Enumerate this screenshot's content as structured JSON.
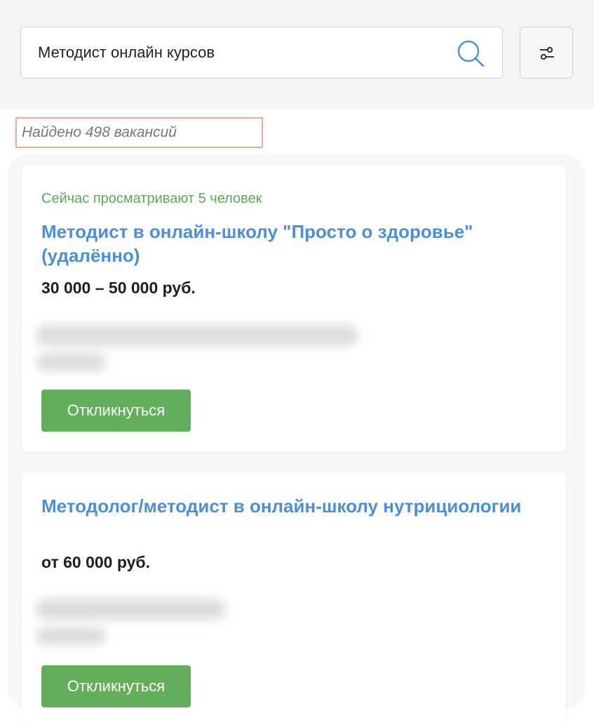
{
  "search": {
    "value": "Методист онлайн курсов"
  },
  "results": {
    "count_text": "Найдено 498 вакансий"
  },
  "vacancies": [
    {
      "viewers": "Сейчас просматривают 5 человек",
      "title": "Методист в онлайн-школу \"Просто о здоровье\" (удалённо)",
      "salary": "30 000 – 50 000 руб.",
      "apply_label": "Откликнуться"
    },
    {
      "title": "Методолог/методист в онлайн-школу нутрициологии",
      "salary": "от 60 000 руб.",
      "apply_label": "Откликнуться"
    }
  ],
  "colors": {
    "accent_blue": "#4a90d9",
    "viewers_green": "#5ba85a",
    "button_green": "#63ae5b",
    "highlight_border": "#f2a98c"
  },
  "icons": {
    "search": "search-icon",
    "filter": "filter-sliders-icon"
  }
}
